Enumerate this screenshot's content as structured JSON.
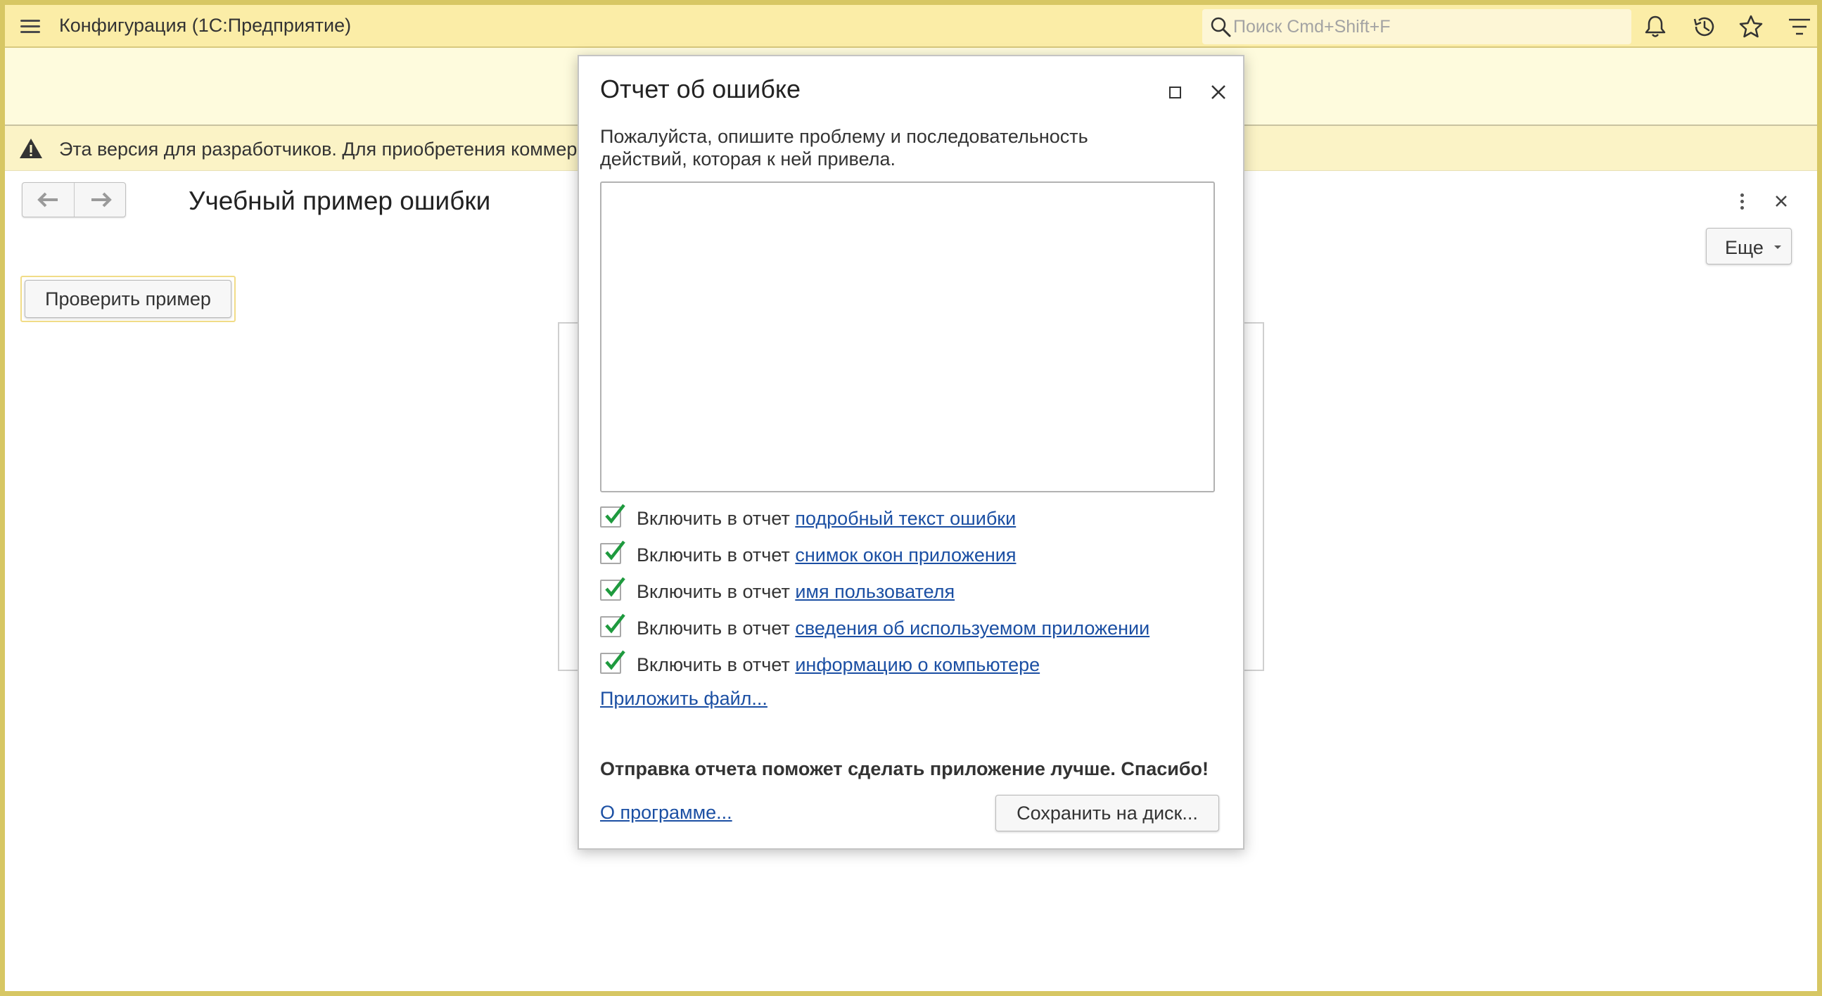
{
  "topbar": {
    "title": "Конфигурация  (1С:Предприятие)",
    "search_placeholder": "Поиск Cmd+Shift+F",
    "icons": [
      "menu-icon",
      "search-icon",
      "bell-icon",
      "history-icon",
      "star-icon",
      "filter-menu-icon"
    ]
  },
  "warning": {
    "text": "Эта версия для разработчиков. Для приобретения коммер"
  },
  "form": {
    "title": "Учебный пример ошибки",
    "more_label": "Еще",
    "check_button": "Проверить пример"
  },
  "dialog": {
    "title": "Отчет об ошибке",
    "description": "Пожалуйста, опишите проблему и последовательность действий, которая к ней привела.",
    "textarea_value": "",
    "options": [
      {
        "prefix": "Включить в отчет",
        "link": "подробный текст ошибки",
        "checked": true
      },
      {
        "prefix": "Включить в отчет",
        "link": "снимок окон приложения",
        "checked": true
      },
      {
        "prefix": "Включить в отчет",
        "link": "имя пользователя",
        "checked": true
      },
      {
        "prefix": "Включить в отчет",
        "link": "сведения об используемом приложении",
        "checked": true
      },
      {
        "prefix": "Включить в отчет",
        "link": "информацию о компьютере",
        "checked": true
      }
    ],
    "attach_link": "Приложить файл...",
    "thanks": "Отправка отчета поможет сделать приложение лучше. Спасибо!",
    "about_link": "О программе...",
    "save_button": "Сохранить на диск..."
  },
  "colors": {
    "topbar_bg": "#fbeda7",
    "warning_bg": "#fbf3c6",
    "link": "#1b4fa3",
    "check": "#1e9a3e",
    "frame": "#d7c764"
  }
}
